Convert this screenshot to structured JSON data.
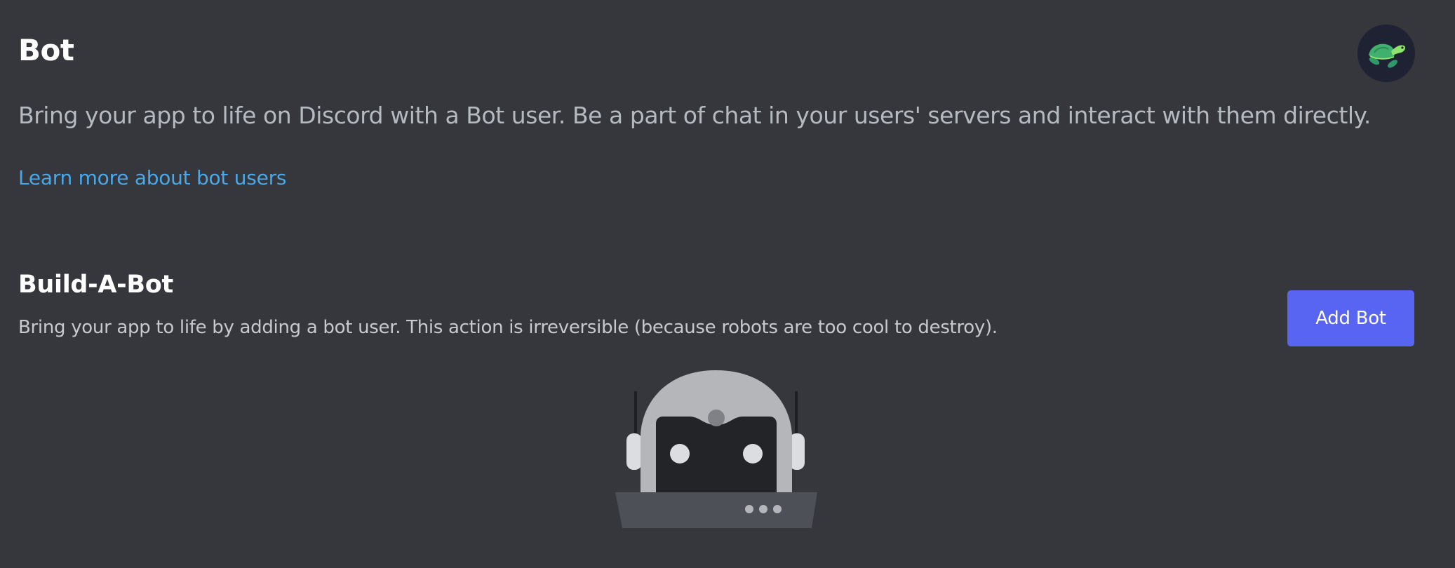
{
  "header": {
    "title": "Bot",
    "description": "Bring your app to life on Discord with a Bot user. Be a part of chat in your users' servers and interact with them directly.",
    "learn_more_link": "Learn more about bot users"
  },
  "user": {
    "avatar_icon": "turtle-icon"
  },
  "build_a_bot": {
    "title": "Build-A-Bot",
    "description": "Bring your app to life by adding a bot user. This action is irreversible (because robots are too cool to destroy).",
    "add_bot_label": "Add Bot",
    "illustration": "robot-illustration"
  },
  "colors": {
    "background": "#36373d",
    "link": "#4aa8e8",
    "primary_button": "#5865f2"
  }
}
